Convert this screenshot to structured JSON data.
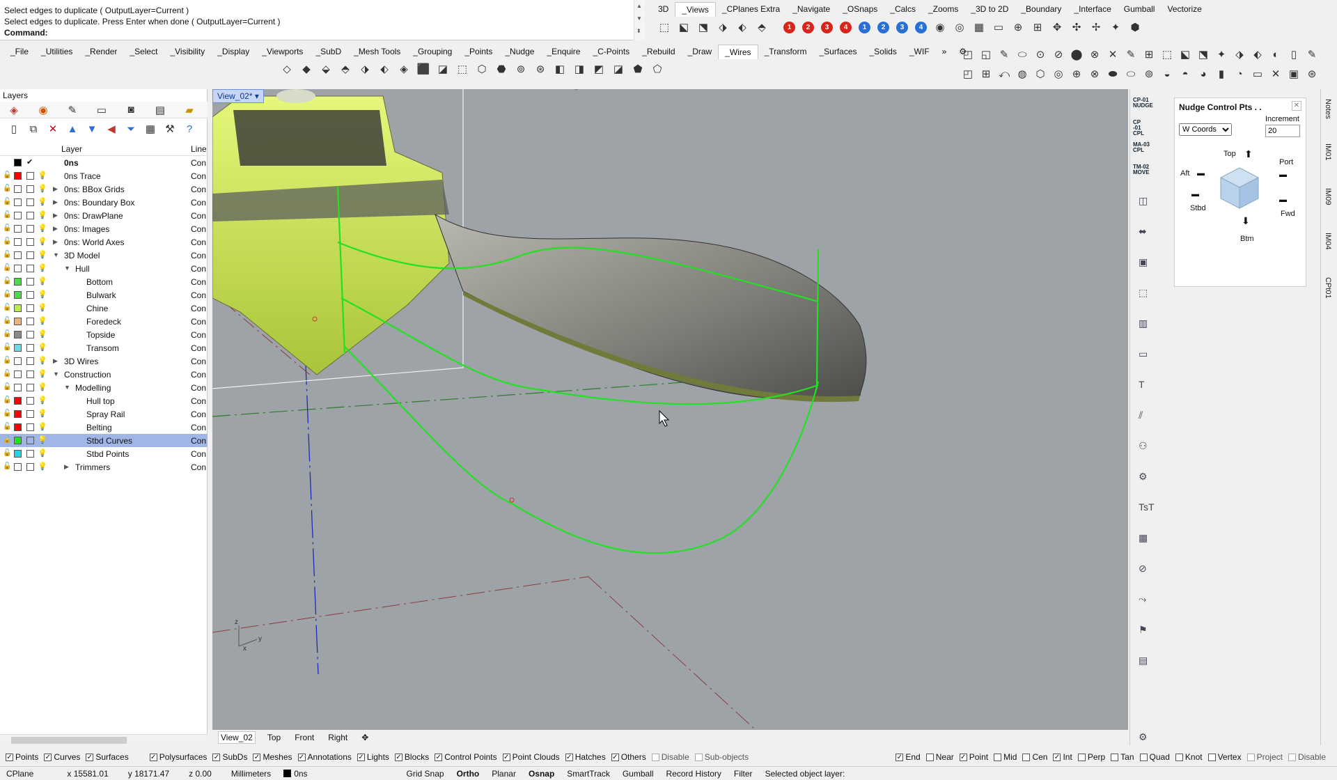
{
  "command": {
    "history": [
      "Select edges to duplicate ( OutputLayer=Current )",
      "Select edges to duplicate. Press Enter when done ( OutputLayer=Current )"
    ],
    "prompt_label": "Command:"
  },
  "toolbar_tabs_top": [
    "3D",
    "_Views",
    "_CPlanes Extra",
    "_Navigate",
    "_OSnaps",
    "_Calcs",
    "_Zooms",
    "_3D to 2D",
    "_Boundary",
    "_Interface",
    "Gumball",
    "Vectorize"
  ],
  "toolbar_tabs_main": [
    "_File",
    "_Utilities",
    "_Render",
    "_Select",
    "_Visibility",
    "_Display",
    "_Viewports",
    "_SubD",
    "_Mesh Tools",
    "_Grouping",
    "_Points",
    "_Nudge",
    "_Enquire",
    "_C-Points",
    "_Rebuild",
    "_Draw",
    "_Wires",
    "_Transform",
    "_Surfaces",
    "_Solids",
    "_WIF"
  ],
  "viewport_dots": [
    {
      "label": "1",
      "color": "#d9241c"
    },
    {
      "label": "2",
      "color": "#d9241c"
    },
    {
      "label": "3",
      "color": "#d9241c"
    },
    {
      "label": "4",
      "color": "#d9241c"
    },
    {
      "label": "1",
      "color": "#2a6fd6"
    },
    {
      "label": "2",
      "color": "#2a6fd6"
    },
    {
      "label": "3",
      "color": "#2a6fd6"
    },
    {
      "label": "4",
      "color": "#2a6fd6"
    }
  ],
  "layers": {
    "panel_title": "Layers",
    "col_layer": "Layer",
    "col_line": "Line",
    "rows": [
      {
        "name": "0ns",
        "level": 0,
        "color": "#000000",
        "current": true,
        "bold": true,
        "expand": "",
        "line": "Con"
      },
      {
        "name": "0ns Trace",
        "level": 0,
        "color": "#ff0000",
        "expand": "",
        "line": "Con"
      },
      {
        "name": "0ns: BBox Grids",
        "level": 0,
        "color": "#ffffff",
        "expand": ">",
        "line": "Con"
      },
      {
        "name": "0ns: Boundary Box",
        "level": 0,
        "color": "#ffffff",
        "expand": ">",
        "line": "Con"
      },
      {
        "name": "0ns: DrawPlane",
        "level": 0,
        "color": "#ffffff",
        "expand": ">",
        "line": "Con"
      },
      {
        "name": "0ns: Images",
        "level": 0,
        "color": "#ffffff",
        "expand": ">",
        "line": "Con"
      },
      {
        "name": "0ns: World Axes",
        "level": 0,
        "color": "#ffffff",
        "expand": ">",
        "line": "Con"
      },
      {
        "name": "3D Model",
        "level": 0,
        "color": "#ffffff",
        "expand": "v",
        "line": "Con"
      },
      {
        "name": "Hull",
        "level": 1,
        "color": "#ffffff",
        "expand": "v",
        "line": "Con"
      },
      {
        "name": "Bottom",
        "level": 2,
        "color": "#4cd94c",
        "expand": "",
        "line": "Con"
      },
      {
        "name": "Bulwark",
        "level": 2,
        "color": "#4cd94c",
        "expand": "",
        "line": "Con"
      },
      {
        "name": "Chine",
        "level": 2,
        "color": "#b7ee4c",
        "expand": "",
        "line": "Con"
      },
      {
        "name": "Foredeck",
        "level": 2,
        "color": "#f0b27a",
        "expand": "",
        "line": "Con"
      },
      {
        "name": "Topside",
        "level": 2,
        "color": "#8a8a8a",
        "expand": "",
        "line": "Con"
      },
      {
        "name": "Transom",
        "level": 2,
        "color": "#6fd9e6",
        "expand": "",
        "line": "Con"
      },
      {
        "name": "3D Wires",
        "level": 0,
        "color": "#ffffff",
        "expand": ">",
        "line": "Con"
      },
      {
        "name": "Construction",
        "level": 0,
        "color": "#ffffff",
        "expand": "v",
        "line": "Con"
      },
      {
        "name": "Modelling",
        "level": 1,
        "color": "#ffffff",
        "expand": "v",
        "line": "Con"
      },
      {
        "name": "Hull top",
        "level": 2,
        "color": "#ff0000",
        "expand": "",
        "line": "Con"
      },
      {
        "name": "Spray Rail",
        "level": 2,
        "color": "#ff0000",
        "expand": "",
        "line": "Con"
      },
      {
        "name": "Belting",
        "level": 2,
        "color": "#ff0000",
        "expand": "",
        "line": "Con"
      },
      {
        "name": "Stbd Curves",
        "level": 2,
        "color": "#22e022",
        "expand": "",
        "selected": true,
        "line": "Con"
      },
      {
        "name": "Stbd Points",
        "level": 2,
        "color": "#22d6e6",
        "expand": "",
        "line": "Con"
      },
      {
        "name": "Trimmers",
        "level": 1,
        "color": "#ffffff",
        "expand": ">",
        "line": "Con"
      }
    ]
  },
  "viewport": {
    "name": "View_02*",
    "bottom_tabs": [
      "View_02",
      "Top",
      "Front",
      "Right"
    ]
  },
  "right_strip": {
    "labels": [
      "CP-01 NUDGE",
      "CP -01 CPL",
      "MA-03 CPL",
      "TM-02 MOVE"
    ]
  },
  "nudge": {
    "title": "Nudge Control Pts . .",
    "coords_value": "W Coords",
    "increment_label": "Increment",
    "increment_value": "20",
    "dir_top": "Top",
    "dir_port": "Port",
    "dir_aft": "Aft",
    "dir_stbd": "Stbd",
    "dir_fwd": "Fwd",
    "dir_btm": "Btm"
  },
  "side_tabs": [
    "Notes",
    "IM01",
    "IM09",
    "IM04",
    "CPt01"
  ],
  "filters": [
    {
      "label": "Points",
      "checked": true
    },
    {
      "label": "Curves",
      "checked": true
    },
    {
      "label": "Surfaces",
      "checked": true
    },
    {
      "label": "Polysurfaces",
      "checked": true
    },
    {
      "label": "SubDs",
      "checked": true
    },
    {
      "label": "Meshes",
      "checked": true
    },
    {
      "label": "Annotations",
      "checked": true
    },
    {
      "label": "Lights",
      "checked": true
    },
    {
      "label": "Blocks",
      "checked": true
    },
    {
      "label": "Control Points",
      "checked": true
    },
    {
      "label": "Point Clouds",
      "checked": true
    },
    {
      "label": "Hatches",
      "checked": true
    },
    {
      "label": "Others",
      "checked": true
    },
    {
      "label": "Disable",
      "checked": false,
      "dim": true
    },
    {
      "label": "Sub-objects",
      "checked": false,
      "dim": true
    }
  ],
  "osnaps": [
    {
      "label": "End",
      "checked": true
    },
    {
      "label": "Near",
      "checked": false
    },
    {
      "label": "Point",
      "checked": true
    },
    {
      "label": "Mid",
      "checked": false
    },
    {
      "label": "Cen",
      "checked": false
    },
    {
      "label": "Int",
      "checked": true
    },
    {
      "label": "Perp",
      "checked": false
    },
    {
      "label": "Tan",
      "checked": false
    },
    {
      "label": "Quad",
      "checked": false
    },
    {
      "label": "Knot",
      "checked": false
    },
    {
      "label": "Vertex",
      "checked": false
    },
    {
      "label": "Project",
      "checked": false,
      "dim": true
    },
    {
      "label": "Disable",
      "checked": false,
      "dim": true
    }
  ],
  "status": {
    "cplane": "CPlane",
    "x": "x 15581.01",
    "y": "y 18171.47",
    "z": "z 0.00",
    "units": "Millimeters",
    "layer": "0ns",
    "grid_snap": "Grid Snap",
    "ortho": "Ortho",
    "planar": "Planar",
    "osnap": "Osnap",
    "smarttrack": "SmartTrack",
    "gumball": "Gumball",
    "record_history": "Record History",
    "filter": "Filter",
    "message": "Selected object layer:"
  }
}
